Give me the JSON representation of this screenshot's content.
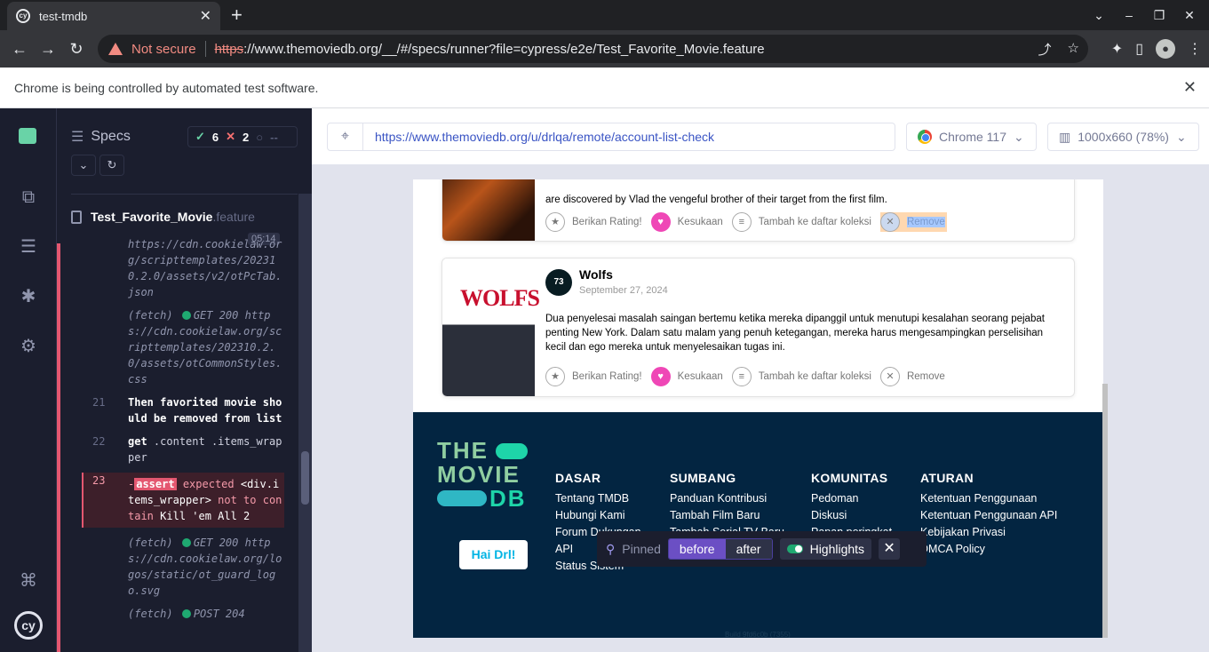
{
  "browser": {
    "tab_title": "test-tmdb",
    "not_secure": "Not secure",
    "url_scheme": "https",
    "url_rest": "://www.themoviedb.org/__/#/specs/runner?file=cypress/e2e/Test_Favorite_Movie.feature",
    "infobar_text": "Chrome is being controlled by automated test software."
  },
  "reporter": {
    "title": "Specs",
    "passed": "6",
    "failed": "2",
    "pending": "--",
    "spec_name": "Test_Favorite_Movie",
    "spec_ext": ".feature",
    "timer": "05:14",
    "log": {
      "l0_text": "https://cdn.cookielaw.org/scripttemplates/202310.2.0/assets/v2/otPcTab.json",
      "l1_label": "(fetch)",
      "l1_status": "GET 200",
      "l1_url": "https://cdn.cookielaw.org/scripttemplates/202310.2.0/assets/otCommonStyles.css",
      "l2_num": "21",
      "l2_kw": "Then",
      "l2_text": "favorited movie should be removed from list",
      "l3_num": "22",
      "l3_cmd": "get",
      "l3_text": ".content .items_wrapper",
      "l4_num": "23",
      "l4_tag": "assert",
      "l4_t1": "expected",
      "l4_t2": "<div.items_wrapper>",
      "l4_t3": "not to contain",
      "l4_t4": "Kill 'em All 2",
      "l5_label": "(fetch)",
      "l5_status": "GET 200",
      "l5_url": "https://cdn.cookielaw.org/logos/static/ot_guard_logo.svg",
      "l6_label": "(fetch)",
      "l6_status": "POST 204"
    }
  },
  "aut": {
    "url": "https://www.themoviedb.org/u/drlqa/remote/account-list-check",
    "browser": "Chrome 117",
    "viewport": "1000x660 (78%)"
  },
  "movies": [
    {
      "overview": "are discovered by Vlad the vengeful brother of their target from the first film.",
      "rate": "Berikan Rating!",
      "fav": "Kesukaan",
      "list": "Tambah ke daftar koleksi",
      "remove": "Remove"
    },
    {
      "score": "73",
      "title": "Wolfs",
      "date": "September 27, 2024",
      "poster_text": "WOLFS",
      "overview": "Dua penyelesai masalah saingan bertemu ketika mereka dipanggil untuk menutupi kesalahan seorang pejabat penting New York. Dalam satu malam yang penuh ketegangan, mereka harus mengesampingkan perselisihan kecil dan ego mereka untuk menyelesaikan tugas ini.",
      "rate": "Berikan Rating!",
      "fav": "Kesukaan",
      "list": "Tambah ke daftar koleksi",
      "remove": "Remove"
    }
  ],
  "footer": {
    "logo_line1": "THE",
    "logo_line2": "MOVIE",
    "logo_line3": "DB",
    "hai_button": "Hai Drl!",
    "cols": [
      {
        "heading": "DASAR",
        "items": [
          "Tentang TMDB",
          "Hubungi Kami",
          "Forum Dukungan",
          "API",
          "Status Sistem"
        ]
      },
      {
        "heading": "SUMBANG",
        "items": [
          "Panduan Kontribusi",
          "Tambah Film Baru",
          "Tambah Serial TV Baru"
        ]
      },
      {
        "heading": "KOMUNITAS",
        "items": [
          "Pedoman",
          "Diskusi",
          "Papan peringkat"
        ]
      },
      {
        "heading": "ATURAN",
        "items": [
          "Ketentuan Penggunaan",
          "Ketentuan Penggunaan API",
          "Kebijakan Privasi",
          "DMCA Policy"
        ]
      }
    ],
    "build": "Build 9fd6c0b (7355)"
  },
  "snapshot": {
    "pinned": "Pinned",
    "before": "before",
    "after": "after",
    "highlights": "Highlights"
  }
}
